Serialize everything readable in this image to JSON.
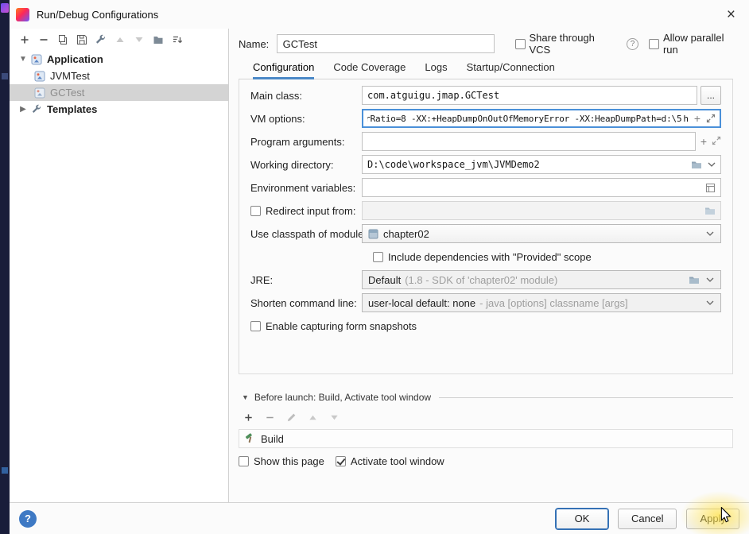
{
  "window": {
    "title": "Run/Debug Configurations",
    "close_label": "×"
  },
  "left_toolbar": {
    "icons": [
      "add",
      "remove",
      "copy",
      "save-configuration",
      "edit-templates",
      "move-up",
      "move-down",
      "new-folder",
      "sort-configurations"
    ]
  },
  "tree": {
    "groups": [
      {
        "label": "Application",
        "expanded": true,
        "children": [
          {
            "label": "JVMTest",
            "selected": false
          },
          {
            "label": "GCTest",
            "selected": true
          }
        ]
      },
      {
        "label": "Templates",
        "expanded": false,
        "children": []
      }
    ]
  },
  "header": {
    "name_label": "Name:",
    "name_value": "GCTest",
    "share_vcs": {
      "label": "Share through VCS",
      "checked": false,
      "help": "?"
    },
    "allow_parallel": {
      "label": "Allow parallel run",
      "checked": false
    }
  },
  "tabs": [
    {
      "label": "Configuration",
      "active": true
    },
    {
      "label": "Code Coverage",
      "active": false
    },
    {
      "label": "Logs",
      "active": false
    },
    {
      "label": "Startup/Connection",
      "active": false
    }
  ],
  "form": {
    "main_class": {
      "label": "Main class:",
      "value": "com.atguigu.jmap.GCTest",
      "browse_label": "..."
    },
    "vm_options": {
      "label": "VM options:",
      "text_before_caret": "rRatio=8 -XX:+HeapDumpOnOutOfMemoryError -XX:HeapDumpPath=d:\\5",
      "text_after_caret": "h"
    },
    "program_arguments": {
      "label": "Program arguments:",
      "value": ""
    },
    "working_directory": {
      "label": "Working directory:",
      "value": "D:\\code\\workspace_jvm\\JVMDemo2"
    },
    "environment_variables": {
      "label": "Environment variables:",
      "value": ""
    },
    "redirect_input": {
      "label": "Redirect input from:",
      "checked": false,
      "value": ""
    },
    "use_classpath": {
      "label": "Use classpath of module:",
      "value": "chapter02"
    },
    "include_provided": {
      "label": "Include dependencies with \"Provided\" scope",
      "checked": false
    },
    "jre": {
      "label": "JRE:",
      "value": "Default",
      "hint": "(1.8 - SDK of 'chapter02' module)"
    },
    "shorten_command_line": {
      "label": "Shorten command line:",
      "value": "user-local default: none",
      "hint": "- java [options] classname [args]"
    },
    "enable_snapshots": {
      "label": "Enable capturing form snapshots",
      "checked": false
    }
  },
  "before_launch": {
    "title": "Before launch: Build, Activate tool window",
    "toolbar_icons": [
      "add",
      "remove",
      "edit",
      "move-up",
      "move-down"
    ],
    "tasks": [
      {
        "label": "Build"
      }
    ],
    "show_this_page": {
      "label": "Show this page",
      "checked": false
    },
    "activate_tool_window": {
      "label": "Activate tool window",
      "checked": true
    }
  },
  "footer": {
    "help": "?",
    "ok_label": "OK",
    "cancel_label": "Cancel",
    "apply_label": "Apply"
  },
  "colors": {
    "accent_blue": "#3f7dc4",
    "tab_underline": "#4a88c7",
    "focus_border": "#4a90d9",
    "selection_bg": "#d4d4d4",
    "cursor_highlight": "#ffe24d",
    "strip_bg": "#191d3a"
  }
}
